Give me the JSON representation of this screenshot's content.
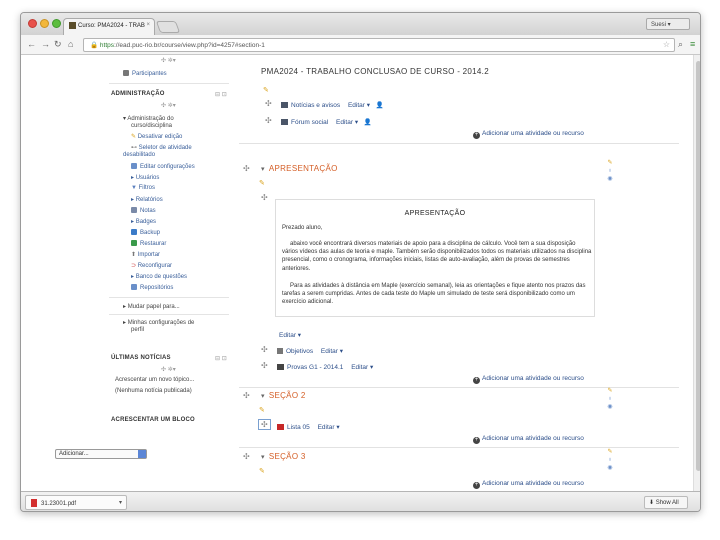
{
  "browser": {
    "tab_title": "Curso: PMA2024 - TRAB",
    "tab_close": "×",
    "user_label": "Suesi",
    "url_scheme": "https",
    "url_rest": "://ead.puc-rio.br/course/view.php?id=4257#section-1"
  },
  "sidebar": {
    "participants": "Participantes",
    "admin_header": "ADMINISTRAÇÃO",
    "admin_course_1": "Administração do",
    "admin_course_2": "curso/disciplina",
    "deactivate_edit": "Desativar edição",
    "activity_1": "Seletor de atividade",
    "activity_2": "desabilitado",
    "edit_settings": "Editar configurações",
    "users": "Usuários",
    "filters": "Filtros",
    "reports": "Relatórios",
    "grades": "Notas",
    "badges": "Badges",
    "backup": "Backup",
    "restore": "Restaurar",
    "import": "Importar",
    "reconfigure": "Reconfigurar",
    "question_bank": "Banco de questões",
    "repositories": "Repositórios",
    "switch_role": "Mudar papel para...",
    "my_profile_1": "Minhas configurações de",
    "my_profile_2": "perfil",
    "news_header": "ÚLTIMAS NOTÍCIAS",
    "add_news": "Acrescentar um novo tópico...",
    "no_news": "(Nenhuma notícia publicada)",
    "block_header": "ACRESCENTAR UM BLOCO",
    "block_select": "Adicionar..."
  },
  "main": {
    "title": "PMA2024 - TRABALHO CONCLUSAO DE CURSO - 2014.2",
    "news_forum": "Notícias e avisos",
    "social_forum": "Fórum social",
    "edit": "Editar",
    "add_activity": "Adicionar uma atividade ou recurso",
    "sec_apresentacao": "APRESENTAÇÃO",
    "label_title": "APRESENTAÇÃO",
    "label_p1": "Prezado aluno,",
    "label_p2": "abaixo você encontrará diversos materiais de apoio para a disciplina de cálculo. Você tem a sua disposição vários vídeos das aulas de teoria e maple. Também serão disponibilizados todos os materiais utilizados na disciplina presencial, como o cronograma, informações iniciais, listas de auto-avaliação, além de provas de semestres anteriores.",
    "label_p3": "Para as atividades à distância em Maple (exercício semanal), leia as orientações e fique atento nos prazos das tarefas a serem cumpridas. Antes de cada teste do Maple um simulado de teste será disponibilizado como um exercício adicional.",
    "objetivos": "Objetivos",
    "provas": "Provas G1 - 2014.1",
    "sec_2": "SEÇÃO 2",
    "lista": "Lista 05",
    "sec_3": "SEÇÃO 3"
  },
  "downloads": {
    "file": "31.23001.pdf",
    "show_all": "Show All"
  },
  "colors": {
    "section_orange": "#d45e26",
    "link_blue": "#2d4f8a",
    "pencil": "#d9a21b"
  }
}
